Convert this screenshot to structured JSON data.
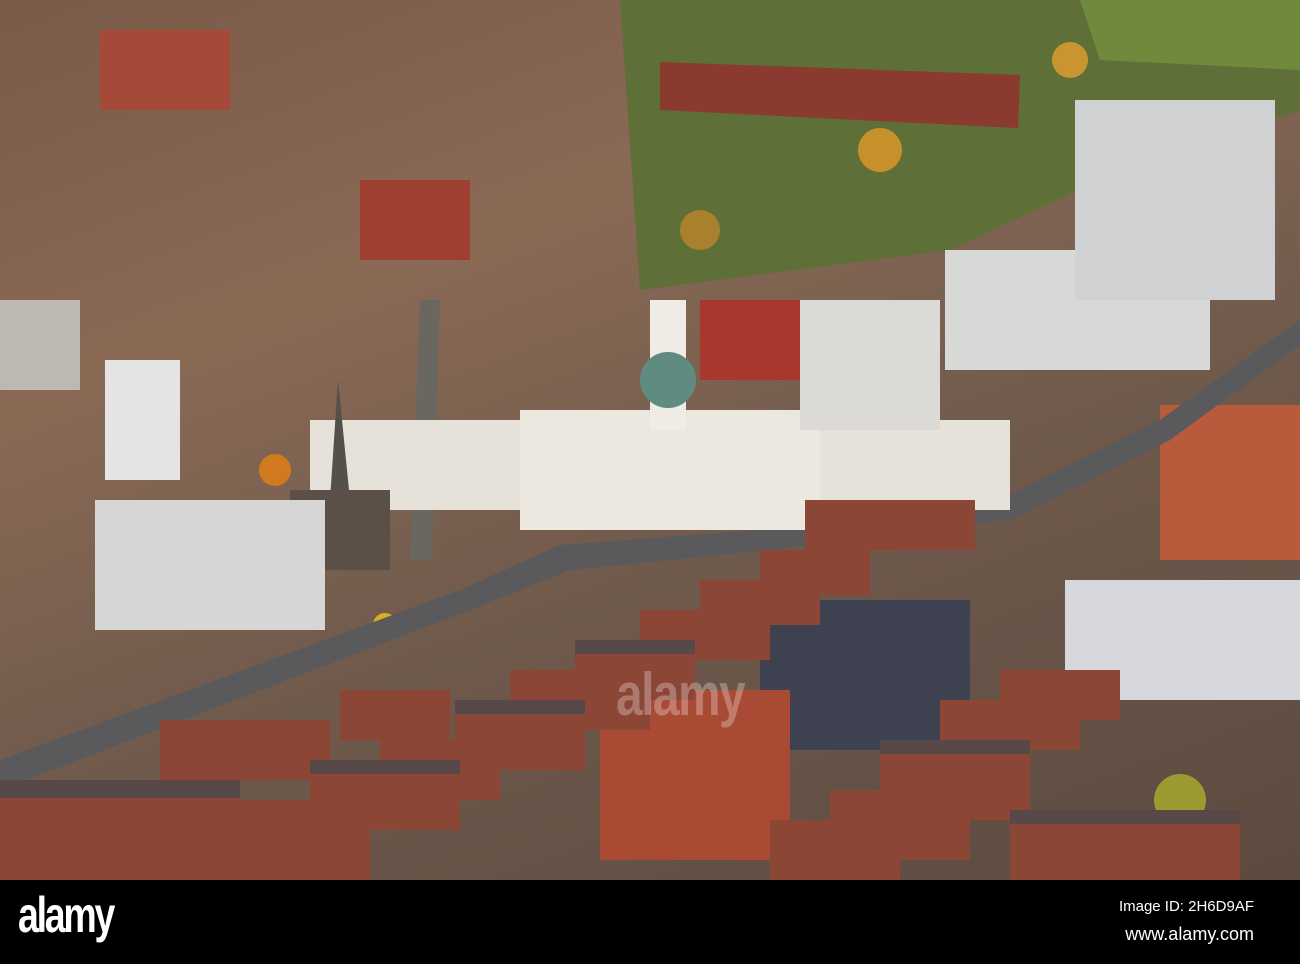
{
  "photo": {
    "subject": "Aerial view of university campus and city"
  },
  "watermark": "alamy",
  "footer": {
    "logo": "alamy",
    "image_id": "Image ID: 2H6D9AF",
    "website": "www.alamy.com"
  }
}
